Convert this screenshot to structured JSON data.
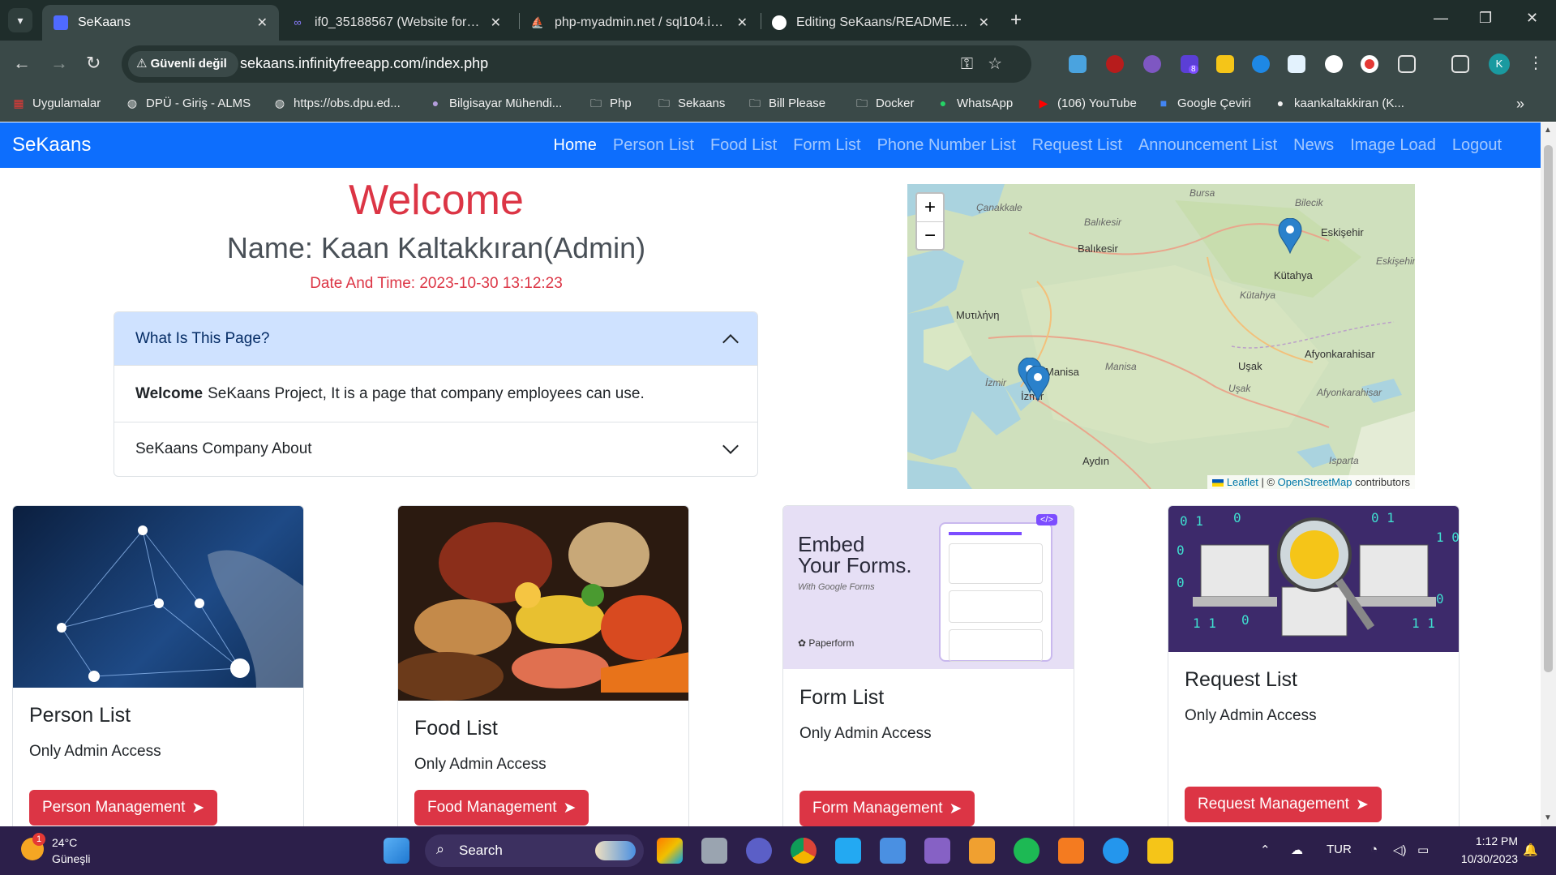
{
  "browser": {
    "tabs": [
      {
        "title": "SeKaans",
        "active": true,
        "favicon": "sekaans-favicon"
      },
      {
        "title": "if0_35188567 (Website for seka",
        "active": false,
        "favicon": "infinityfree-favicon"
      },
      {
        "title": "php-myadmin.net / sql104.infin",
        "active": false,
        "favicon": "phpmyadmin-favicon"
      },
      {
        "title": "Editing SeKaans/README.md a",
        "active": false,
        "favicon": "github-favicon"
      }
    ],
    "security_label": "Güvenli değil",
    "url": "sekaans.infinityfreeapp.com/index.php",
    "profile_initial": "K",
    "extension_badge": "8",
    "bookmarks": [
      {
        "label": "Uygulamalar",
        "icon": "apps-grid-icon"
      },
      {
        "label": "DPÜ - Giriş - ALMS",
        "icon": "globe-icon"
      },
      {
        "label": "https://obs.dpu.ed...",
        "icon": "globe-icon"
      },
      {
        "label": "Bilgisayar Mühendi...",
        "icon": "dpu-icon"
      },
      {
        "label": "Php",
        "icon": "folder-icon"
      },
      {
        "label": "Sekaans",
        "icon": "folder-icon"
      },
      {
        "label": "Bill Please",
        "icon": "folder-icon"
      },
      {
        "label": "Docker",
        "icon": "folder-icon"
      },
      {
        "label": "WhatsApp",
        "icon": "whatsapp-icon"
      },
      {
        "label": "(106) YouTube",
        "icon": "youtube-icon"
      },
      {
        "label": "Google Çeviri",
        "icon": "google-translate-icon"
      },
      {
        "label": "kaankaltakkiran (K...",
        "icon": "github-icon"
      }
    ]
  },
  "site": {
    "brand": "SeKaans",
    "nav": [
      "Home",
      "Person List",
      "Food List",
      "Form List",
      "Phone Number List",
      "Request List",
      "Announcement List",
      "News",
      "Image Load",
      "Logout"
    ],
    "active_nav": "Home"
  },
  "welcome": {
    "title": "Welcome",
    "name": "Name: Kaan Kaltakkıran(Admin)",
    "datetime": "Date And Time: 2023-10-30 13:12:23"
  },
  "accordion": {
    "item1_header": "What Is This Page?",
    "item1_body_bold": "Welcome",
    "item1_body_text": "SeKaans Project, It is a page that company employees can use.",
    "item2_header": "SeKaans Company About"
  },
  "map": {
    "zoom_in": "+",
    "zoom_out": "−",
    "labels": [
      "Çanakkale",
      "Balıkesir",
      "Balıkesir",
      "Bursa",
      "Bilecik",
      "Eskişehir",
      "Eskişehir",
      "Kütahya",
      "Kütahya",
      "Μυτιλήνη",
      "Manisa",
      "Manisa",
      "İzmir",
      "İzmir",
      "Uşak",
      "Uşak",
      "Afyonkarahisar",
      "Afyonkarahisar",
      "Aydın",
      "Isparta"
    ],
    "attribution_leaflet": "Leaflet",
    "attribution_sep": " | © ",
    "attribution_osm": "OpenStreetMap",
    "attribution_tail": " contributors"
  },
  "cards": [
    {
      "title": "Person List",
      "text": "Only Admin Access",
      "button": "Person Management",
      "image": "network-people-image"
    },
    {
      "title": "Food List",
      "text": "Only Admin Access",
      "button": "Food Management",
      "image": "food-table-image"
    },
    {
      "title": "Form List",
      "text": "Only Admin Access",
      "button": "Form Management",
      "image": "embed-forms-image",
      "image_heading_1": "Embed",
      "image_heading_2": "Your Forms.",
      "image_sub": "With Google Forms",
      "image_brand": "Paperform",
      "image_tag": "</>"
    },
    {
      "title": "Request List",
      "text": "Only Admin Access",
      "button": "Request Management",
      "image": "binary-lightbulb-image"
    }
  ],
  "taskbar": {
    "temperature": "24°C",
    "weather_desc": "Güneşli",
    "weather_badge": "1",
    "search_label": "Search",
    "language": "TUR",
    "time": "1:12 PM",
    "date": "10/30/2023"
  },
  "colors": {
    "primary": "#0d6efd",
    "danger": "#dc3545",
    "chrome_dark": "#1f2d2b",
    "taskbar": "#2c1f4a"
  }
}
